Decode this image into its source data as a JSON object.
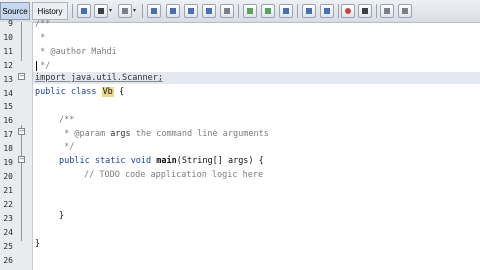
{
  "toolbar": {
    "source_tab": "Source",
    "history_tab": "History"
  },
  "gutter": {
    "line_numbers": [
      "9",
      "10",
      "11",
      "12",
      "13",
      "14",
      "15",
      "16",
      "17",
      "18",
      "19",
      "20",
      "21",
      "22",
      "23",
      "24",
      "25",
      "26"
    ]
  },
  "editor": {
    "line_9": "/**",
    "line_10": " *",
    "line_11": " * @author Mahdi",
    "line_12": " */",
    "line_13": "import java.util.Scanner;",
    "line_14_kw1": "public",
    "line_14_kw2": "class",
    "line_14_name": "Vb",
    "line_14_brace": "{",
    "line_16": "/**",
    "line_17_a": " * @param ",
    "line_17_b": "args",
    "line_17_c": " the command line arguments",
    "line_18": " */",
    "line_19_kw1": "public",
    "line_19_kw2": "static",
    "line_19_kw3": "void",
    "line_19_method": "main",
    "line_19_rest": "(String[] args) {",
    "line_20": "// TODO code application logic here",
    "line_23": "}",
    "line_26": "}"
  }
}
